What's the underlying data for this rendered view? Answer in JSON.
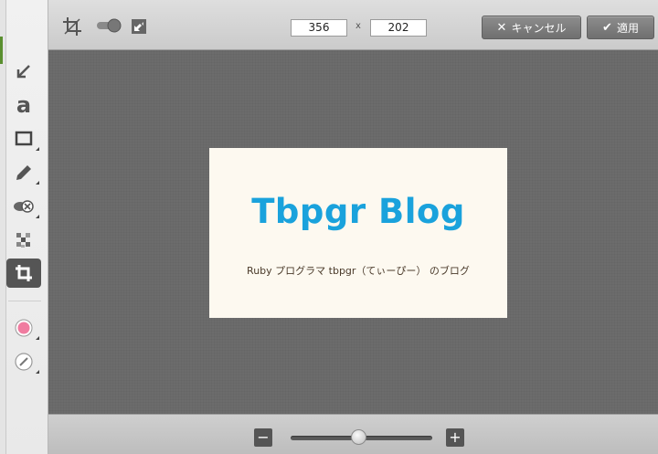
{
  "toolbar": {
    "width_value": "356",
    "height_value": "202",
    "times_label": "x",
    "cancel_label": "キャンセル",
    "apply_label": "適用",
    "icons": [
      "crop-icon",
      "toggle-icon",
      "resize-icon"
    ]
  },
  "tools": [
    {
      "name": "arrow-tool",
      "icon": "arrow-icon"
    },
    {
      "name": "text-tool",
      "icon": "text-a-icon"
    },
    {
      "name": "rectangle-tool",
      "icon": "rectangle-icon"
    },
    {
      "name": "pen-tool",
      "icon": "pencil-icon"
    },
    {
      "name": "blur-tool",
      "icon": "blur-icon"
    },
    {
      "name": "mosaic-tool",
      "icon": "mosaic-icon"
    },
    {
      "name": "crop-tool",
      "icon": "crop-icon",
      "active": true
    },
    {
      "name": "color-tool",
      "icon": "color-swatch-icon",
      "color": "#f07ca0"
    },
    {
      "name": "line-width-tool",
      "icon": "slash-circle-icon"
    }
  ],
  "canvas": {
    "card_title": "Tbpgr Blog",
    "card_subtitle": "Ruby プログラマ tbpgr（てぃーぴー） のブログ",
    "title_color": "#1aa2dc"
  },
  "zoom": {
    "minus_label": "−",
    "plus_label": "+",
    "level": 0.48
  }
}
